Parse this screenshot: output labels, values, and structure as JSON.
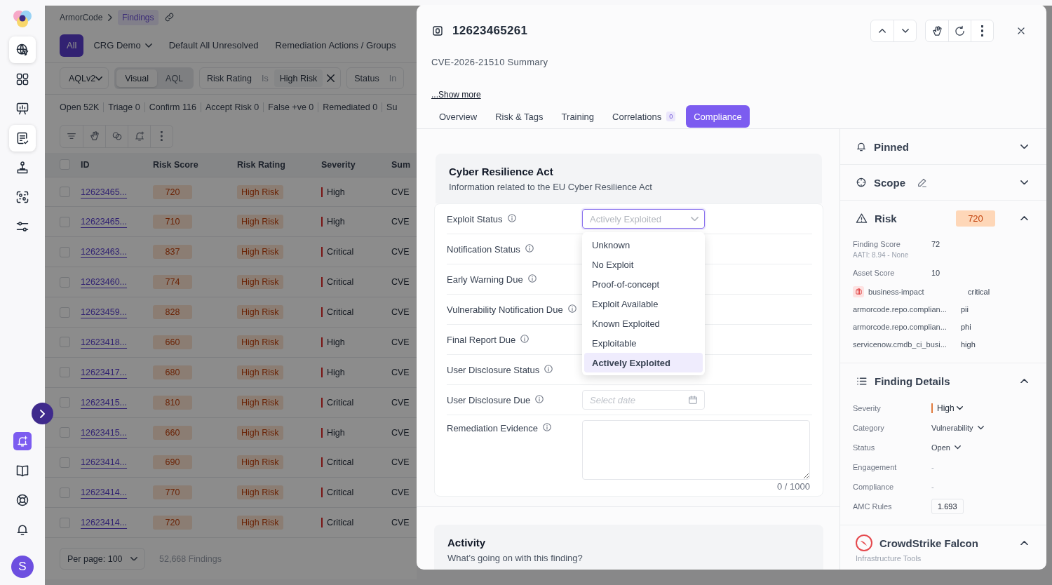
{
  "sidebar": {
    "top_items": [
      {
        "selected": true
      },
      {
        "selected": false
      },
      {
        "selected": false
      },
      {
        "selected": true
      },
      {
        "selected": false
      },
      {
        "selected": false
      },
      {
        "selected": false
      }
    ],
    "bottom_items": [
      {
        "selected": true
      },
      {
        "selected": false
      },
      {
        "selected": false
      },
      {
        "selected": false
      }
    ],
    "avatar": "S"
  },
  "findings_page": {
    "breadcrumb": [
      "ArmorCode",
      "Findings"
    ],
    "views": [
      {
        "label": "All",
        "selected": true,
        "has_menu": false
      },
      {
        "label": "CRG Demo",
        "selected": false,
        "has_menu": true
      },
      {
        "label": "Default All Unresolved",
        "selected": false,
        "has_menu": false
      },
      {
        "label": "Remediation Actions / Groups",
        "selected": false,
        "has_menu": false
      }
    ],
    "query": {
      "language": "AQLv2",
      "modes": [
        {
          "label": "Visual",
          "selected": true
        },
        {
          "label": "AQL",
          "selected": false
        }
      ],
      "filters": [
        {
          "field": "Risk Rating",
          "operator": "Is",
          "value": "High Risk",
          "removable": true
        },
        {
          "field": "Status",
          "operator": "In",
          "removable": false
        }
      ]
    },
    "status_counts": [
      "Open 52K",
      "Triage 0",
      "Confirm 116",
      "Accept Risk 0",
      "False +ve 0",
      "Remediated 0",
      "Su"
    ],
    "table": {
      "all_checked": false,
      "columns": [
        "ID",
        "Risk Score",
        "Risk Rating",
        "Severity",
        "Sum"
      ],
      "rows": [
        {
          "checked": false,
          "id": "12623465...",
          "risk_score": "720",
          "risk_rating": "High Risk",
          "severity": "High",
          "summary": "CVE"
        },
        {
          "checked": false,
          "id": "12623465...",
          "risk_score": "710",
          "risk_rating": "High Risk",
          "severity": "High",
          "summary": "CVE"
        },
        {
          "checked": false,
          "id": "12623463...",
          "risk_score": "837",
          "risk_rating": "High Risk",
          "severity": "Critical",
          "summary": "CVE"
        },
        {
          "checked": false,
          "id": "12623460...",
          "risk_score": "774",
          "risk_rating": "High Risk",
          "severity": "Critical",
          "summary": "CVE"
        },
        {
          "checked": false,
          "id": "12623459...",
          "risk_score": "828",
          "risk_rating": "High Risk",
          "severity": "Critical",
          "summary": "CVE"
        },
        {
          "checked": false,
          "id": "12623418...",
          "risk_score": "660",
          "risk_rating": "High Risk",
          "severity": "High",
          "summary": "CVE"
        },
        {
          "checked": false,
          "id": "12623417...",
          "risk_score": "680",
          "risk_rating": "High Risk",
          "severity": "High",
          "summary": "CVE"
        },
        {
          "checked": false,
          "id": "12623415...",
          "risk_score": "810",
          "risk_rating": "High Risk",
          "severity": "Critical",
          "summary": "CVE"
        },
        {
          "checked": false,
          "id": "12623415...",
          "risk_score": "660",
          "risk_rating": "High Risk",
          "severity": "High",
          "summary": "CVE"
        },
        {
          "checked": false,
          "id": "12623414...",
          "risk_score": "690",
          "risk_rating": "High Risk",
          "severity": "Critical",
          "summary": "CVE"
        },
        {
          "checked": false,
          "id": "12623414...",
          "risk_score": "770",
          "risk_rating": "High Risk",
          "severity": "Critical",
          "summary": "CVE"
        },
        {
          "checked": false,
          "id": "12623414...",
          "risk_score": "720",
          "risk_rating": "High Risk",
          "severity": "Critical",
          "summary": "CVE"
        }
      ]
    },
    "footer": {
      "per_page": "Per page: 100",
      "total": "52,668 Findings"
    }
  },
  "finding_panel": {
    "title": "12623465261",
    "summary": "CVE-2026-21510 Summary",
    "show_more": "...Show more",
    "tabs": [
      {
        "label": "Overview",
        "selected": false
      },
      {
        "label": "Risk & Tags",
        "selected": false
      },
      {
        "label": "Training",
        "selected": false
      },
      {
        "label": "Correlations",
        "badge": "0",
        "selected": false
      },
      {
        "label": "Compliance",
        "selected": true
      }
    ],
    "compliance_card": {
      "title": "Cyber Resilience Act",
      "subtitle": "Information related to the EU Cyber Resilience Act",
      "fields": [
        {
          "label": "Exploit Status",
          "kind": "select",
          "value": "Actively Exploited",
          "open": true,
          "options": [
            {
              "label": "Unknown",
              "selected": false
            },
            {
              "label": "No Exploit",
              "selected": false
            },
            {
              "label": "Proof-of-concept",
              "selected": false
            },
            {
              "label": "Exploit Available",
              "selected": false
            },
            {
              "label": "Known Exploited",
              "selected": false
            },
            {
              "label": "Exploitable",
              "selected": false
            },
            {
              "label": "Actively Exploited",
              "selected": true
            }
          ]
        },
        {
          "label": "Notification Status"
        },
        {
          "label": "Early Warning Due"
        },
        {
          "label": "Vulnerability Notification Due"
        },
        {
          "label": "Final Report Due"
        },
        {
          "label": "User Disclosure Status"
        },
        {
          "label": "User Disclosure Due",
          "kind": "date",
          "placeholder": "Select date"
        },
        {
          "label": "Remediation Evidence",
          "kind": "textarea",
          "counter": "0 / 1000"
        }
      ]
    },
    "activity": {
      "title": "Activity",
      "subtitle": "What’s going on with this finding?"
    },
    "side": {
      "pinned": {
        "title": "Pinned",
        "expanded": false
      },
      "scope": {
        "title": "Scope",
        "expanded": false
      },
      "risk": {
        "title": "Risk",
        "badge": "720",
        "expanded": true,
        "scores": [
          {
            "label": "Finding Score",
            "value": "72",
            "note": "AATI: 8.94 - None"
          },
          {
            "label": "Asset Score",
            "value": "10"
          }
        ],
        "tags": [
          {
            "key": "business-impact",
            "value": "critical",
            "kind": "flagged"
          },
          {
            "key": "armorcode.repo.complian...",
            "value": "pii",
            "kind": "plain"
          },
          {
            "key": "armorcode.repo.complian...",
            "value": "phi",
            "kind": "plain"
          },
          {
            "key": "servicenow.cmdb_ci_busi...",
            "value": "high",
            "kind": "plain"
          }
        ]
      },
      "finding_details": {
        "title": "Finding Details",
        "expanded": true,
        "fields": [
          {
            "label": "Severity",
            "value": "High",
            "kind": "severity"
          },
          {
            "label": "Category",
            "value": "Vulnerability",
            "kind": "dropdown"
          },
          {
            "label": "Status",
            "value": "Open",
            "kind": "dropdown"
          },
          {
            "label": "Engagement",
            "value": "-",
            "kind": "text"
          },
          {
            "label": "Compliance",
            "value": "-",
            "kind": "text"
          },
          {
            "label": "AMC Rules",
            "value": "1.693",
            "kind": "chip"
          }
        ]
      },
      "integration": {
        "title": "CrowdStrike Falcon",
        "subtitle": "Infrastructure Tools",
        "expanded": true
      }
    }
  }
}
